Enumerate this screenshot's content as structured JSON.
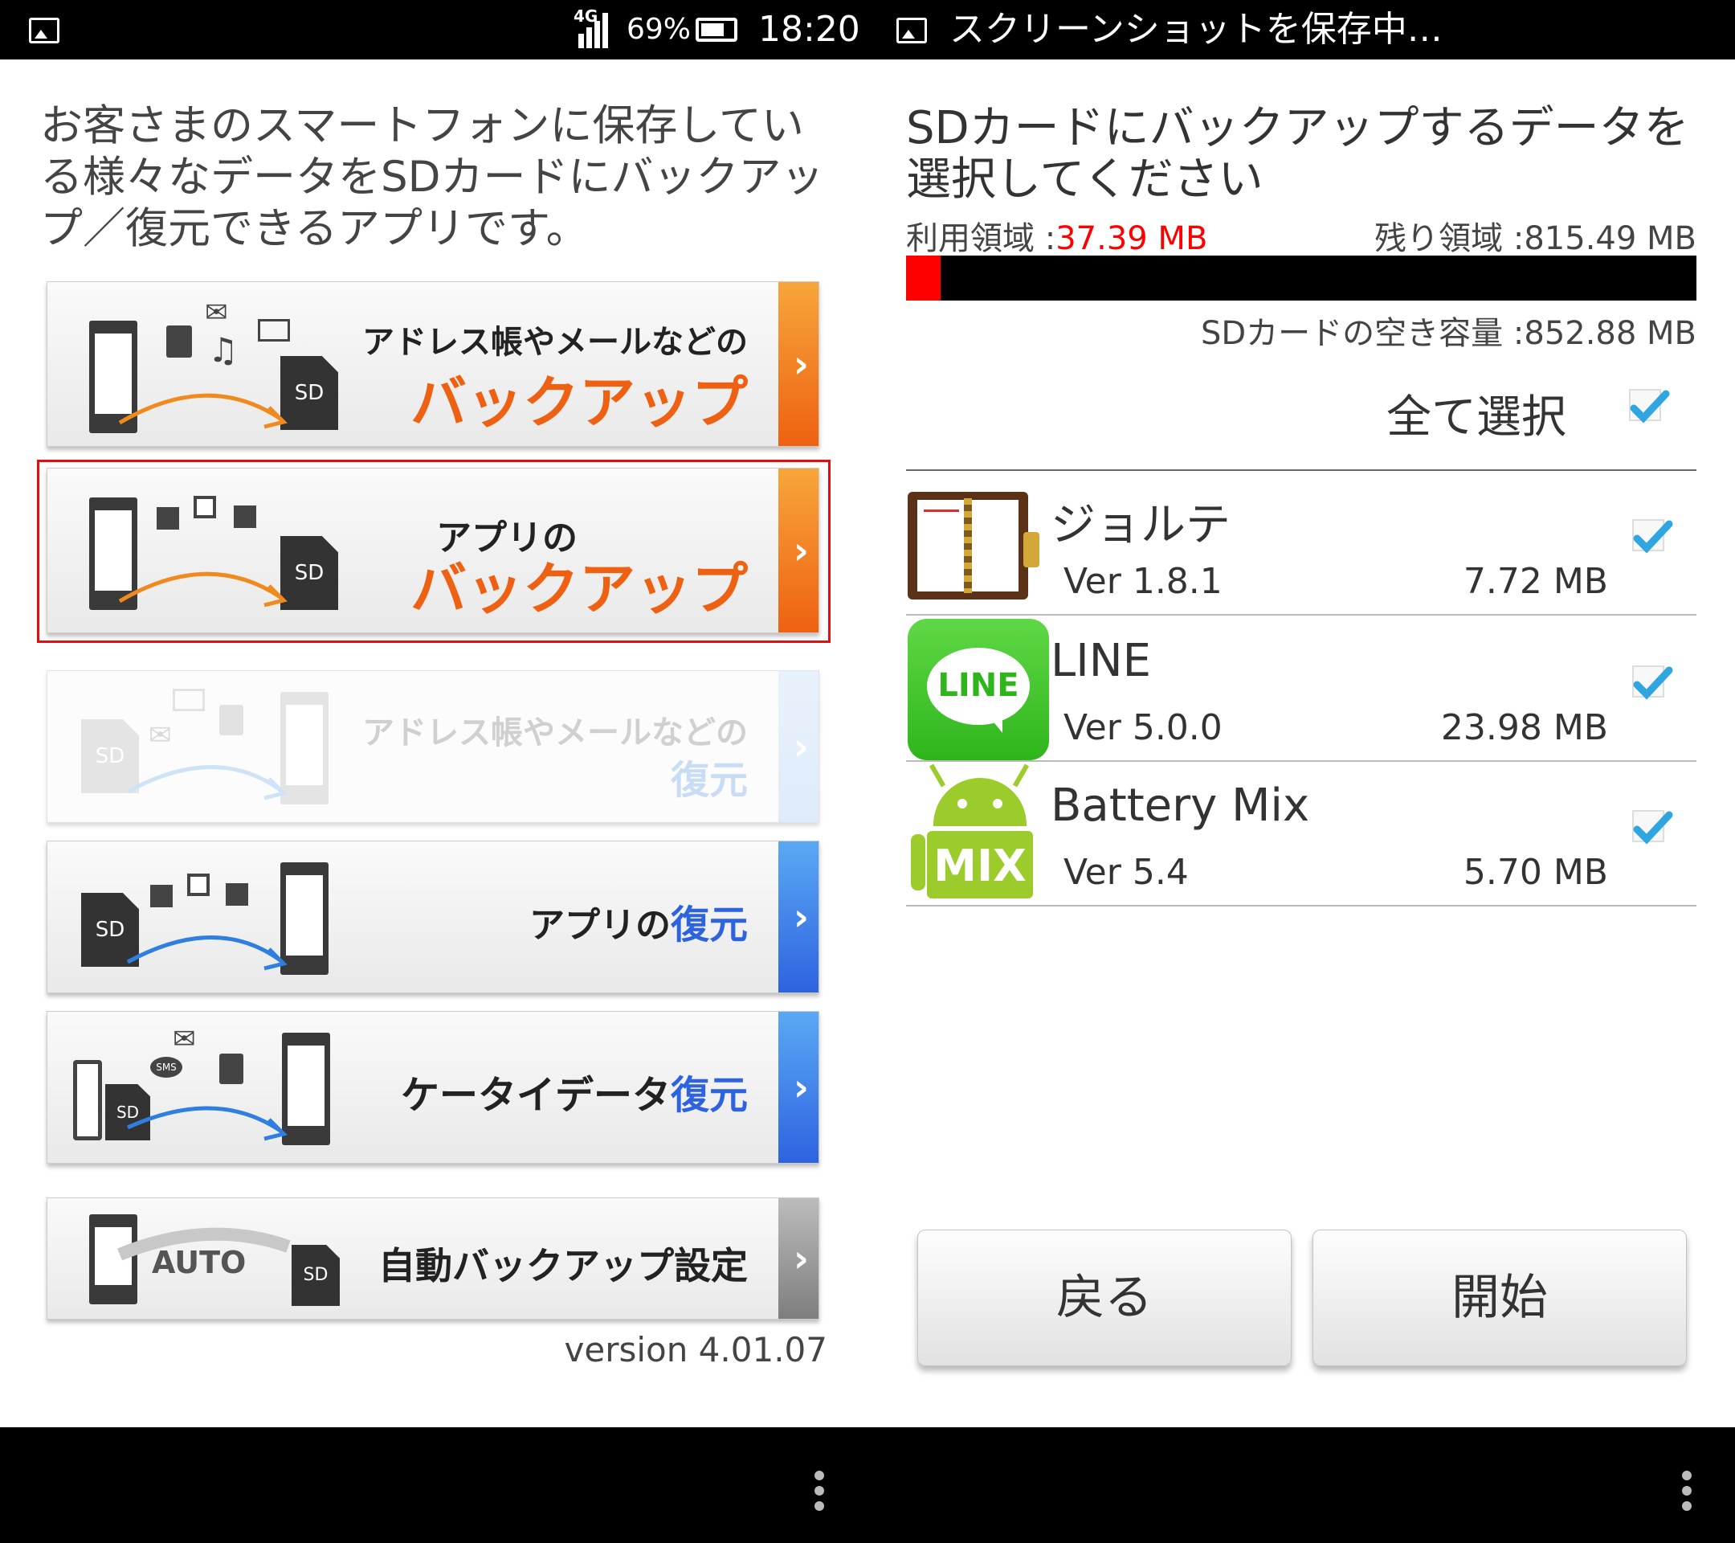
{
  "status_bar": {
    "network": "4G",
    "battery": "69%",
    "time": "18:20",
    "notification": "スクリーンショットを保存中…",
    "icons": [
      "picture-icon",
      "signal-icon",
      "battery-icon"
    ]
  },
  "left_panel": {
    "intro": "お客さまのスマートフォンに保存している様々なデータをSDカードにバックアップ／復元できるアプリです。",
    "menu": [
      {
        "line1": "アドレス帳やメールなどの",
        "line2": "バックアップ",
        "accent": "#ee6112",
        "enabled": true,
        "selected": false
      },
      {
        "line1": "アプリの",
        "line2": "バックアップ",
        "accent": "#ee6112",
        "enabled": true,
        "selected": true
      },
      {
        "line1": "アドレス帳やメールなどの",
        "line2": "復元",
        "accent": "#c6dcf6",
        "enabled": false,
        "selected": false
      },
      {
        "line1": "アプリの",
        "line2": "復元",
        "accent": "#2e63e0",
        "enabled": true,
        "selected": false
      },
      {
        "line1": "ケータイデータ",
        "line2": "復元",
        "accent": "#2e63e0",
        "enabled": true,
        "selected": false
      },
      {
        "line1": "自動バックアップ設定",
        "line2": "",
        "accent": "#7e7e7e",
        "enabled": true,
        "selected": false
      }
    ],
    "icon_labels": {
      "sd": "SD",
      "sms": "SMS",
      "auto": "AUTO"
    },
    "chevron": "›",
    "version": "version 4.01.07"
  },
  "right_panel": {
    "title": "SDカードにバックアップするデータを選択してください",
    "used_label": "利用領域 :",
    "used_value": "37.39 MB",
    "remaining": "残り領域 :815.49 MB",
    "sd_free": "SDカードの空き容量 :852.88 MB",
    "usage_fraction": 0.044,
    "select_all": "全て選択",
    "select_all_checked": true,
    "apps": [
      {
        "name": "ジョルテ",
        "version": "Ver 1.8.1",
        "size": "7.72 MB",
        "checked": true,
        "icon": "jorte-icon"
      },
      {
        "name": "LINE",
        "version": "Ver 5.0.0",
        "size": "23.98 MB",
        "checked": true,
        "icon": "line-icon",
        "icon_text": "LINE"
      },
      {
        "name": "Battery Mix",
        "version": "Ver 5.4",
        "size": "5.70 MB",
        "checked": true,
        "icon": "battery-mix-icon",
        "icon_text": "MIX"
      }
    ],
    "back_button": "戻る",
    "start_button": "開始"
  },
  "colors": {
    "used_value": "#ff0000",
    "check": "#2fa6e0",
    "orange_accent": "#ee6112",
    "blue_accent": "#2e63e0",
    "selection_border": "#e01010"
  }
}
